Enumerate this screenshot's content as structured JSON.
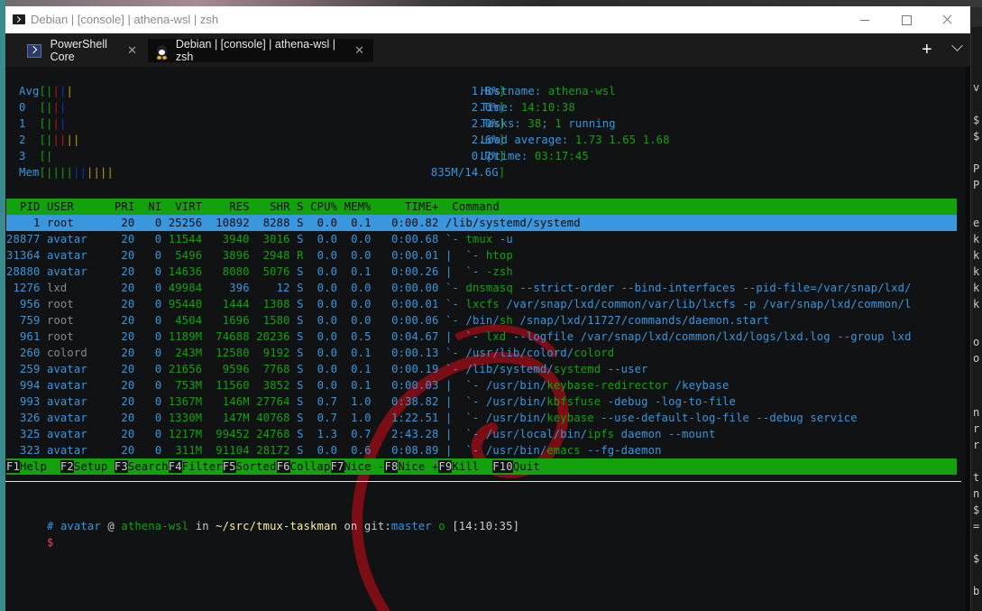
{
  "window": {
    "title": "Debian | [console] | athena-wsl | zsh",
    "controls": {
      "minimize": "minimize",
      "maximize": "maximize",
      "close": "close"
    }
  },
  "tabs": [
    {
      "label": "PowerShell Core",
      "icon": "powershell-icon",
      "active": false
    },
    {
      "label": "Debian | [console] | athena-wsl | zsh",
      "icon": "tux-linux-icon",
      "active": true
    }
  ],
  "tabbar": {
    "new_tab": "+",
    "close_glyph": "✕"
  },
  "htop": {
    "meters": [
      {
        "label": "Avg",
        "value": "1.8%"
      },
      {
        "label": "0  ",
        "value": "2.0%"
      },
      {
        "label": "1  ",
        "value": "2.0%"
      },
      {
        "label": "2  ",
        "value": "2.6%"
      },
      {
        "label": "3  ",
        "value": "0.7%"
      },
      {
        "label": "Mem",
        "value": "835M/14.6G"
      }
    ],
    "info": {
      "hostname_label": "Hostname: ",
      "hostname": "athena-wsl",
      "time_label": "Time: ",
      "time": "14:10:38",
      "tasks_label": "Tasks: ",
      "tasks": "38",
      "tasks_sep": "; ",
      "running": "1",
      "running_label": " running",
      "load_label": "Load average: ",
      "load": "1.73 1.65 1.68",
      "uptime_label": "Uptime: ",
      "uptime": "03:17:45"
    },
    "columns": [
      "PID",
      "USER",
      "PRI",
      "NI",
      "VIRT",
      "RES",
      "SHR",
      "S",
      "CPU%",
      "MEM%",
      "TIME+",
      "Command"
    ],
    "processes": [
      {
        "pid": "1",
        "user": "root",
        "pri": "20",
        "ni": "0",
        "virt": "25256",
        "res": "10892",
        "shr": "8288",
        "s": "S",
        "cpu": "0.0",
        "mem": "0.1",
        "time": "0:00.82",
        "tree": "",
        "cmd_path": "/lib/systemd/",
        "cmd_bin": "systemd",
        "cmd_args": "",
        "selected": true
      },
      {
        "pid": "28877",
        "user": "avatar",
        "pri": "20",
        "ni": "0",
        "virt": "11544",
        "res": "3940",
        "shr": "3016",
        "s": "S",
        "cpu": "0.0",
        "mem": "0.0",
        "time": "0:00.68",
        "tree": "`- ",
        "cmd_path": "",
        "cmd_bin": "tmux",
        "cmd_args": " -u"
      },
      {
        "pid": "31364",
        "user": "avatar",
        "pri": "20",
        "ni": "0",
        "virt": "5496",
        "res": "3896",
        "shr": "2948",
        "s": "R",
        "cpu": "0.0",
        "mem": "0.0",
        "time": "0:00.01",
        "tree": "|  `- ",
        "cmd_path": "",
        "cmd_bin": "htop",
        "cmd_args": ""
      },
      {
        "pid": "28880",
        "user": "avatar",
        "pri": "20",
        "ni": "0",
        "virt": "14636",
        "res": "8080",
        "shr": "5076",
        "s": "S",
        "cpu": "0.0",
        "mem": "0.1",
        "time": "0:00.26",
        "tree": "|  `- ",
        "cmd_path": "",
        "cmd_bin": "-zsh",
        "cmd_args": ""
      },
      {
        "pid": "1276",
        "user": "lxd",
        "pri": "20",
        "ni": "0",
        "virt": "49984",
        "res": "396",
        "shr": "12",
        "s": "S",
        "cpu": "0.0",
        "mem": "0.0",
        "time": "0:00.00",
        "tree": "`- ",
        "cmd_path": "",
        "cmd_bin": "dnsmasq",
        "cmd_args": " --strict-order --bind-interfaces --pid-file=/var/snap/lxd/"
      },
      {
        "pid": "956",
        "user": "root",
        "pri": "20",
        "ni": "0",
        "virt": "95440",
        "res": "1444",
        "shr": "1308",
        "s": "S",
        "cpu": "0.0",
        "mem": "0.0",
        "time": "0:00.01",
        "tree": "`- ",
        "cmd_path": "",
        "cmd_bin": "lxcfs",
        "cmd_args": " /var/snap/lxd/common/var/lib/lxcfs -p /var/snap/lxd/common/l"
      },
      {
        "pid": "759",
        "user": "root",
        "pri": "20",
        "ni": "0",
        "virt": "4504",
        "res": "1696",
        "shr": "1580",
        "s": "S",
        "cpu": "0.0",
        "mem": "0.0",
        "time": "0:00.06",
        "tree": "`- ",
        "cmd_path": "/bin/",
        "cmd_bin": "sh",
        "cmd_args": " /snap/lxd/11727/commands/daemon.start"
      },
      {
        "pid": "961",
        "user": "root",
        "pri": "20",
        "ni": "0",
        "virt": "1189M",
        "res": "74688",
        "shr": "20236",
        "s": "S",
        "cpu": "0.0",
        "mem": "0.5",
        "time": "0:04.67",
        "tree": "|  `- ",
        "cmd_path": "",
        "cmd_bin": "lxd",
        "cmd_args": " --logfile /var/snap/lxd/common/lxd/logs/lxd.log --group lxd"
      },
      {
        "pid": "260",
        "user": "colord",
        "pri": "20",
        "ni": "0",
        "virt": "243M",
        "res": "12580",
        "shr": "9192",
        "s": "S",
        "cpu": "0.0",
        "mem": "0.1",
        "time": "0:00.13",
        "tree": "`- ",
        "cmd_path": "/usr/lib/colord/",
        "cmd_bin": "colord",
        "cmd_args": ""
      },
      {
        "pid": "259",
        "user": "avatar",
        "pri": "20",
        "ni": "0",
        "virt": "21656",
        "res": "9596",
        "shr": "7768",
        "s": "S",
        "cpu": "0.0",
        "mem": "0.1",
        "time": "0:00.19",
        "tree": "`- ",
        "cmd_path": "/lib/systemd/",
        "cmd_bin": "systemd",
        "cmd_args": " --user"
      },
      {
        "pid": "994",
        "user": "avatar",
        "pri": "20",
        "ni": "0",
        "virt": "753M",
        "res": "11560",
        "shr": "3852",
        "s": "S",
        "cpu": "0.0",
        "mem": "0.1",
        "time": "0:00.03",
        "tree": "|  `- ",
        "cmd_path": "/usr/bin/",
        "cmd_bin": "keybase-redirector",
        "cmd_args": " /keybase"
      },
      {
        "pid": "993",
        "user": "avatar",
        "pri": "20",
        "ni": "0",
        "virt": "1367M",
        "res": "146M",
        "shr": "27764",
        "s": "S",
        "cpu": "0.7",
        "mem": "1.0",
        "time": "0:38.82",
        "tree": "|  `- ",
        "cmd_path": "/usr/bin/",
        "cmd_bin": "kbfsfuse",
        "cmd_args": " -debug -log-to-file"
      },
      {
        "pid": "326",
        "user": "avatar",
        "pri": "20",
        "ni": "0",
        "virt": "1330M",
        "res": "147M",
        "shr": "40768",
        "s": "S",
        "cpu": "0.7",
        "mem": "1.0",
        "time": "1:22.51",
        "tree": "|  `- ",
        "cmd_path": "/usr/bin/",
        "cmd_bin": "keybase",
        "cmd_args": " --use-default-log-file --debug service"
      },
      {
        "pid": "325",
        "user": "avatar",
        "pri": "20",
        "ni": "0",
        "virt": "1217M",
        "res": "99452",
        "shr": "24768",
        "s": "S",
        "cpu": "1.3",
        "mem": "0.7",
        "time": "2:43.28",
        "tree": "|  `- ",
        "cmd_path": "/usr/local/bin/",
        "cmd_bin": "ipfs",
        "cmd_args": " daemon --mount"
      },
      {
        "pid": "323",
        "user": "avatar",
        "pri": "20",
        "ni": "0",
        "virt": "311M",
        "res": "91104",
        "shr": "28172",
        "s": "S",
        "cpu": "0.0",
        "mem": "0.6",
        "time": "0:08.89",
        "tree": "|  `- ",
        "cmd_path": "/usr/bin/",
        "cmd_bin": "emacs",
        "cmd_args": " --fg-daemon"
      }
    ],
    "function_keys": [
      {
        "key": "F1",
        "label": "Help  "
      },
      {
        "key": "F2",
        "label": "Setup "
      },
      {
        "key": "F3",
        "label": "Search"
      },
      {
        "key": "F4",
        "label": "Filter"
      },
      {
        "key": "F5",
        "label": "Sorted"
      },
      {
        "key": "F6",
        "label": "Collap"
      },
      {
        "key": "F7",
        "label": "Nice -"
      },
      {
        "key": "F8",
        "label": "Nice +"
      },
      {
        "key": "F9",
        "label": "Kill  "
      },
      {
        "key": "F10",
        "label": "Quit"
      }
    ]
  },
  "prompt": {
    "hash": "#",
    "user": "avatar",
    "at": " @ ",
    "host": "athena-wsl",
    "in": " in ",
    "cwd": "~/src/tmux-taskman",
    "on": " on ",
    "git_label": "git:",
    "branch": "master",
    "status": " o ",
    "timestamp": "[14:10:35]",
    "cursor_prompt": "$"
  },
  "right_pane_fragments": [
    "v",
    "$",
    "$",
    "P",
    "P",
    "e",
    "k",
    "k",
    "k",
    "k",
    "k",
    "o",
    "o",
    "n",
    "r",
    "r",
    "t",
    "n",
    "$",
    "=",
    "$",
    "b"
  ]
}
